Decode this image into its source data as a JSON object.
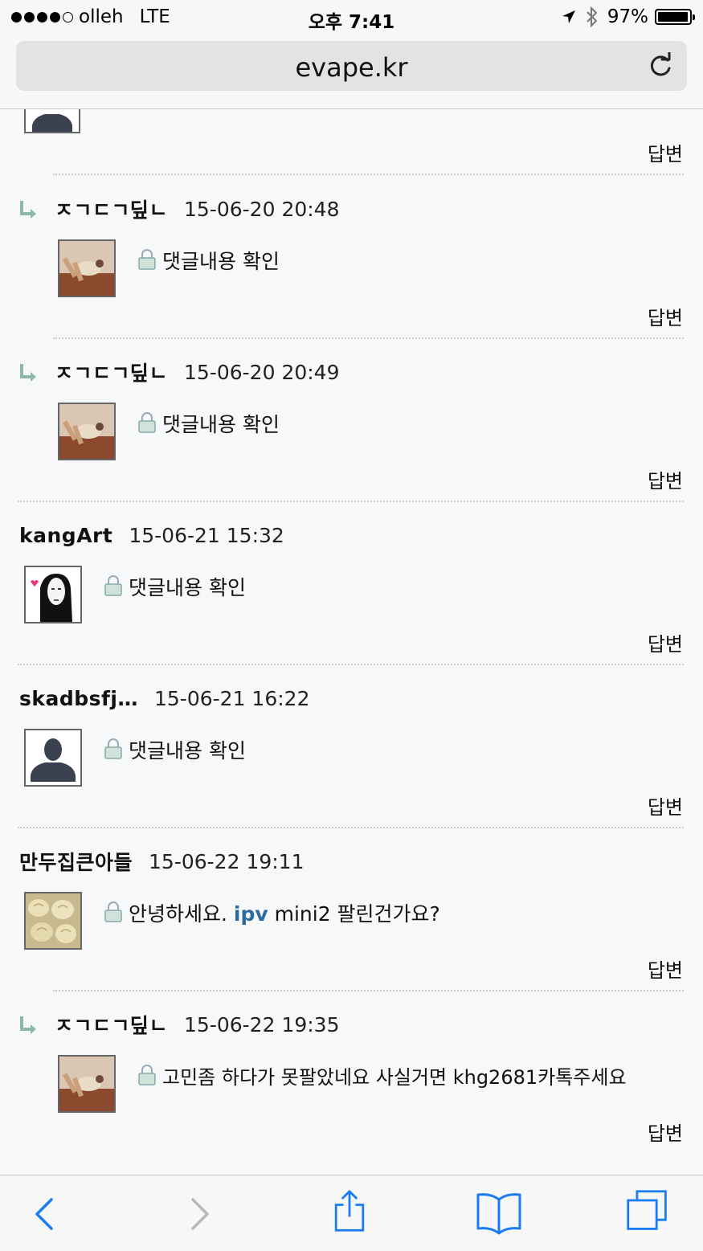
{
  "status_bar": {
    "carrier": "olleh",
    "network": "LTE",
    "time": "오후 7:41",
    "battery": "97%",
    "battery_level": 0.97
  },
  "browser": {
    "url": "evape.kr"
  },
  "comments": [
    {
      "author": "ㅈㄱㄷㄱ딮ㄴ",
      "date": "15-06-20 20:48",
      "text": "댓글내용 확인",
      "reply": "답변",
      "is_reply": true,
      "avatar": "person-photo"
    },
    {
      "author": "ㅈㄱㄷㄱ딮ㄴ",
      "date": "15-06-20 20:49",
      "text": "댓글내용 확인",
      "reply": "답변",
      "is_reply": true,
      "avatar": "person-photo"
    },
    {
      "author": "kangArt",
      "date": "15-06-21 15:32",
      "text": "댓글내용 확인",
      "reply": "답변",
      "is_reply": false,
      "avatar": "no-face-character"
    },
    {
      "author": "skadbsfj…",
      "date": "15-06-21 16:22",
      "text": "댓글내용 확인",
      "reply": "답변",
      "is_reply": false,
      "avatar": "default-silhouette"
    },
    {
      "author": "만두집큰아들",
      "date": "15-06-22 19:11",
      "text_before": "안녕하세요. ",
      "text_link": "ipv",
      "text_after": " mini2 팔린건가요?",
      "reply": "답변",
      "is_reply": false,
      "avatar": "dumpling-photo"
    },
    {
      "author": "ㅈㄱㄷㄱ딮ㄴ",
      "date": "15-06-22 19:35",
      "text": "고민좀 하다가 못팔았네요 사실거면 khg2681카톡주세요",
      "reply": "답변",
      "is_reply": true,
      "avatar": "person-photo"
    }
  ],
  "top_reply_label": "답변",
  "toolbar": {
    "back": "chevron-left-icon",
    "forward": "chevron-right-icon",
    "share": "share-icon",
    "bookmarks": "book-icon",
    "tabs": "tabs-icon"
  }
}
